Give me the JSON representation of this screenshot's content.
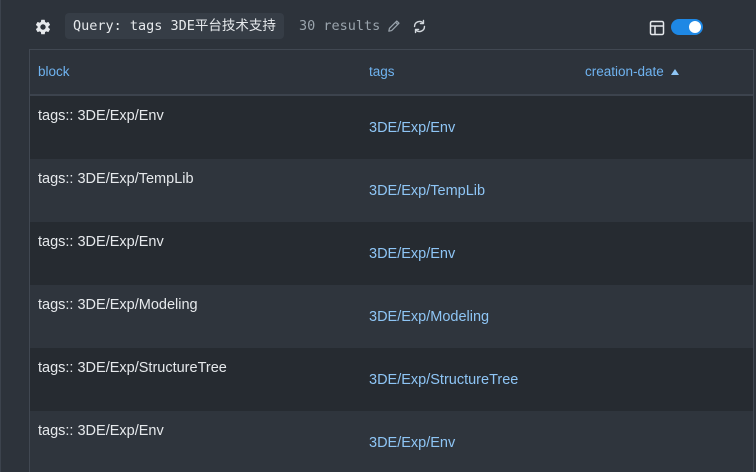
{
  "query": {
    "label": "Query: tags 3DE平台技术支持",
    "results": "30 results"
  },
  "toolbar": {
    "icons": [
      "gear-icon",
      "pencil-icon",
      "refresh-icon",
      "table-view-icon"
    ],
    "toggle_on": true
  },
  "colors": {
    "accent": "#1e88e5",
    "link": "#8ec5f5",
    "header": "#6fb3f0"
  },
  "table": {
    "columns": [
      "block",
      "tags",
      "creation-date"
    ],
    "sorted_column": "creation-date",
    "sort_direction": "ascending",
    "rows": [
      {
        "block": "tags:: 3DE/Exp/Env",
        "tags": "3DE/Exp/Env"
      },
      {
        "block": "tags:: 3DE/Exp/TempLib",
        "tags": "3DE/Exp/TempLib"
      },
      {
        "block": "tags:: 3DE/Exp/Env",
        "tags": "3DE/Exp/Env"
      },
      {
        "block": "tags:: 3DE/Exp/Modeling",
        "tags": "3DE/Exp/Modeling"
      },
      {
        "block": "tags:: 3DE/Exp/StructureTree",
        "tags": "3DE/Exp/StructureTree"
      },
      {
        "block": "tags:: 3DE/Exp/Env",
        "tags": "3DE/Exp/Env"
      }
    ]
  }
}
